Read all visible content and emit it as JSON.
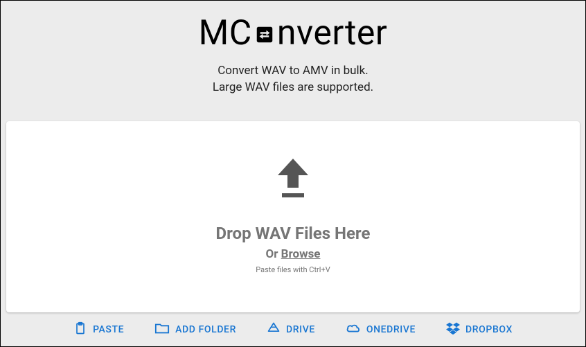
{
  "header": {
    "logo_pre": "MC",
    "logo_post": "nverter",
    "subtitle_line1": "Convert WAV to AMV in bulk.",
    "subtitle_line2": "Large WAV files are supported."
  },
  "dropzone": {
    "drop_text": "Drop WAV Files Here",
    "or_text": "Or ",
    "browse_text": "Browse",
    "hint": "Paste files with Ctrl+V"
  },
  "bottombar": {
    "paste": "PASTE",
    "add_folder": "ADD FOLDER",
    "drive": "DRIVE",
    "onedrive": "ONEDRIVE",
    "dropbox": "DROPBOX"
  },
  "colors": {
    "accent": "#1976d2",
    "muted": "#757575",
    "bg": "#ececec"
  }
}
